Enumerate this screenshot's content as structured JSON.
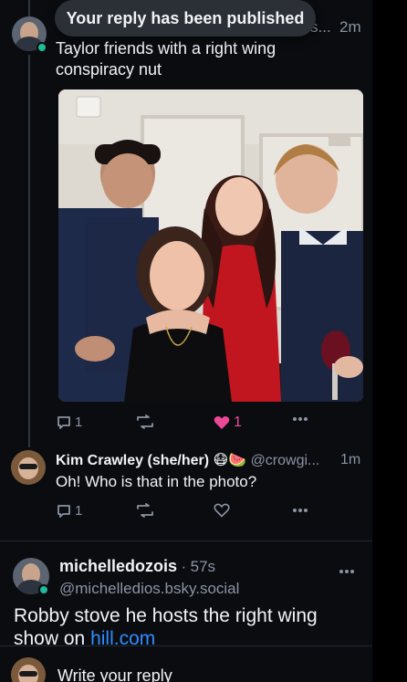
{
  "toast": {
    "message": "Your reply has been published"
  },
  "posts": [
    {
      "author_fragment": "s...",
      "time": "2m",
      "text": "Taylor friends with a right wing conspiracy nut",
      "image_alt": "Group photo of four people at a party",
      "replies": "1",
      "reposts": "",
      "likes": "1",
      "liked": true
    },
    {
      "name": "Kim Crawley (she/her) 😷🍉",
      "handle": "@crowgi...",
      "time": "1m",
      "text": "Oh! Who is that in the photo?",
      "replies": "1",
      "reposts": "",
      "likes": ""
    },
    {
      "name": "michelledozois",
      "time_sep": "·",
      "time": "57s",
      "handle": "@michelledios.bsky.social",
      "text_before": "Robby stove he hosts the right wing show on ",
      "link_text": "hill.com"
    }
  ],
  "composer": {
    "placeholder": "Write your reply"
  },
  "colors": {
    "background": "#0a0c10",
    "like": "#ec4899",
    "link": "#2f8cff",
    "muted": "#8a94a3"
  },
  "icons": [
    "reply-icon",
    "repost-icon",
    "heart-icon",
    "more-icon",
    "verified-badge-icon"
  ]
}
